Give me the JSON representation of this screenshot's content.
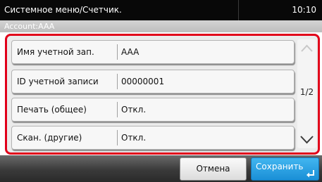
{
  "titlebar": {
    "title": "Системное меню/Счетчик.",
    "time": "10:10"
  },
  "subheader": {
    "account": "Account:AAA"
  },
  "rows": [
    {
      "label": "Имя учетной зап.",
      "value": "AAA"
    },
    {
      "label": "ID учетной записи",
      "value": "00000001"
    },
    {
      "label": "Печать (общее)",
      "value": "Откл."
    },
    {
      "label": "Скан. (другие)",
      "value": "Откл."
    }
  ],
  "pagination": {
    "indicator": "1/2"
  },
  "icons": {
    "up": "chevron-up-icon",
    "down": "chevron-down-icon",
    "enter": "enter-arrow-icon"
  },
  "footer": {
    "cancel_label": "Отмена",
    "save_label": "Сохранить"
  },
  "colors": {
    "highlight_border": "#e1001a",
    "save_button": "#2aa3e6",
    "title_bar": "#080808"
  }
}
